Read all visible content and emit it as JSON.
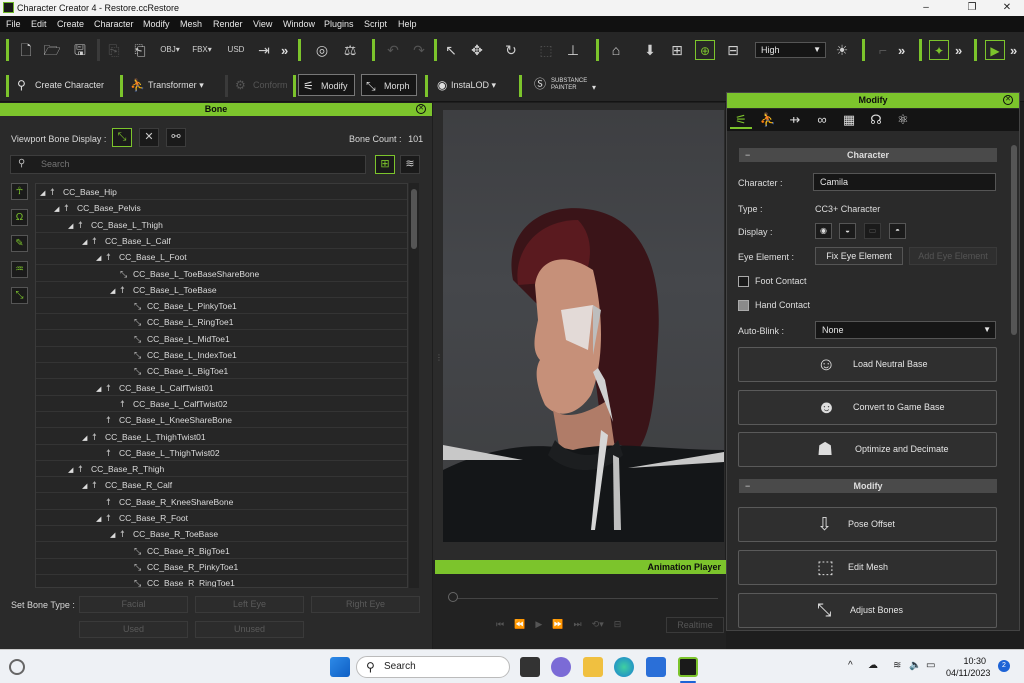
{
  "window": {
    "title": "Character Creator 4 - Restore.ccRestore",
    "minimize": "–",
    "maximize": "❐",
    "close": "✕"
  },
  "menu": [
    "File",
    "Edit",
    "Create",
    "Character",
    "Modify",
    "Mesh",
    "Render",
    "View",
    "Window",
    "Plugins",
    "Script",
    "Help"
  ],
  "toolbar1": {
    "quality_select": "High",
    "icons": [
      "new-file-icon",
      "open-folder-icon",
      "save-icon",
      "import-icon",
      "export-icon",
      "obj-icon",
      "fbx-icon",
      "usd-icon",
      "send-icon",
      "camera-reset-icon",
      "pose-icon",
      "undo-icon",
      "redo-icon",
      "select-icon",
      "move-icon",
      "rotate-icon",
      "scale-icon",
      "snap-icon",
      "home-icon",
      "fit-icon",
      "frame-icon",
      "pick-icon",
      "grid-icon",
      "light-icon",
      "ik-icon",
      "render-icon",
      "play-icon"
    ]
  },
  "toolbar2": {
    "create_character": "Create Character",
    "transformer": "Transformer",
    "conform": "Conform",
    "modify": "Modify",
    "morph": "Morph",
    "instalod": "InstaLOD",
    "substance_line1": "SUBSTANCE",
    "substance_line2": "PAINTER"
  },
  "bone_panel": {
    "title": "Bone",
    "viewport_bone_display_label": "Viewport Bone Display :",
    "bone_count_label": "Bone Count :",
    "bone_count": "101",
    "search_placeholder": "Search",
    "bones": [
      {
        "name": "CC_Base_Hip",
        "indent": 0,
        "expand": "◢",
        "icon": "bone"
      },
      {
        "name": "CC_Base_Pelvis",
        "indent": 1,
        "expand": "◢",
        "icon": "bone"
      },
      {
        "name": "CC_Base_L_Thigh",
        "indent": 2,
        "expand": "◢",
        "icon": "bone"
      },
      {
        "name": "CC_Base_L_Calf",
        "indent": 3,
        "expand": "◢",
        "icon": "bone"
      },
      {
        "name": "CC_Base_L_Foot",
        "indent": 4,
        "expand": "◢",
        "icon": "bone"
      },
      {
        "name": "CC_Base_L_ToeBaseShareBone",
        "indent": 5,
        "expand": "",
        "icon": "share"
      },
      {
        "name": "CC_Base_L_ToeBase",
        "indent": 5,
        "expand": "◢",
        "icon": "bone"
      },
      {
        "name": "CC_Base_L_PinkyToe1",
        "indent": 6,
        "expand": "",
        "icon": "share"
      },
      {
        "name": "CC_Base_L_RingToe1",
        "indent": 6,
        "expand": "",
        "icon": "share"
      },
      {
        "name": "CC_Base_L_MidToe1",
        "indent": 6,
        "expand": "",
        "icon": "share"
      },
      {
        "name": "CC_Base_L_IndexToe1",
        "indent": 6,
        "expand": "",
        "icon": "share"
      },
      {
        "name": "CC_Base_L_BigToe1",
        "indent": 6,
        "expand": "",
        "icon": "share"
      },
      {
        "name": "CC_Base_L_CalfTwist01",
        "indent": 4,
        "expand": "◢",
        "icon": "bone"
      },
      {
        "name": "CC_Base_L_CalfTwist02",
        "indent": 5,
        "expand": "",
        "icon": "bone"
      },
      {
        "name": "CC_Base_L_KneeShareBone",
        "indent": 4,
        "expand": "",
        "icon": "bone"
      },
      {
        "name": "CC_Base_L_ThighTwist01",
        "indent": 3,
        "expand": "◢",
        "icon": "bone"
      },
      {
        "name": "CC_Base_L_ThighTwist02",
        "indent": 4,
        "expand": "",
        "icon": "bone"
      },
      {
        "name": "CC_Base_R_Thigh",
        "indent": 2,
        "expand": "◢",
        "icon": "bone"
      },
      {
        "name": "CC_Base_R_Calf",
        "indent": 3,
        "expand": "◢",
        "icon": "bone"
      },
      {
        "name": "CC_Base_R_KneeShareBone",
        "indent": 4,
        "expand": "",
        "icon": "bone"
      },
      {
        "name": "CC_Base_R_Foot",
        "indent": 4,
        "expand": "◢",
        "icon": "bone"
      },
      {
        "name": "CC_Base_R_ToeBase",
        "indent": 5,
        "expand": "◢",
        "icon": "bone"
      },
      {
        "name": "CC_Base_R_BigToe1",
        "indent": 6,
        "expand": "",
        "icon": "share"
      },
      {
        "name": "CC_Base_R_PinkyToe1",
        "indent": 6,
        "expand": "",
        "icon": "share"
      },
      {
        "name": "CC_Base_R_RingToe1",
        "indent": 6,
        "expand": "",
        "icon": "share"
      }
    ],
    "set_bone_type_label": "Set Bone Type :",
    "bone_types": [
      "Facial",
      "Left Eye",
      "Right Eye",
      "Used",
      "Unused"
    ]
  },
  "animation_player": {
    "title": "Animation Player",
    "realtime": "Realtime"
  },
  "modify_panel": {
    "title": "Modify",
    "character_section": "Character",
    "character_label": "Character :",
    "character_value": "Camila",
    "type_label": "Type :",
    "type_value": "CC3+ Character",
    "display_label": "Display :",
    "eye_element_label": "Eye Element :",
    "fix_eye_element": "Fix Eye Element",
    "add_eye_element": "Add Eye Element",
    "foot_contact": "Foot Contact",
    "hand_contact": "Hand Contact",
    "auto_blink_label": "Auto-Blink :",
    "auto_blink_value": "None",
    "load_neutral_base": "Load Neutral Base",
    "convert_to_game_base": "Convert to Game Base",
    "optimize_and_decimate": "Optimize and Decimate",
    "modify_section": "Modify",
    "pose_offset": "Pose Offset",
    "edit_mesh": "Edit Mesh",
    "adjust_bones": "Adjust Bones"
  },
  "taskbar": {
    "search": "Search",
    "time": "10:30",
    "date": "04/11/2023",
    "notifications": "2"
  },
  "colors": {
    "accent": "#7cc42c",
    "panel": "#2a2a2a",
    "toolbar": "#262626"
  }
}
